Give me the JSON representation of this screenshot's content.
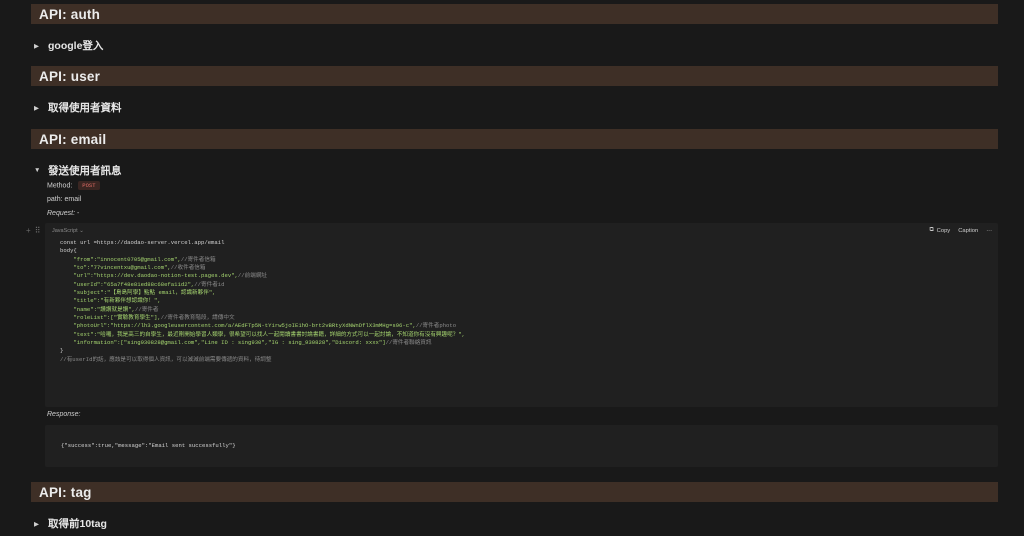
{
  "sections": {
    "auth": {
      "heading": "API: auth",
      "toggle": "google登入"
    },
    "user": {
      "heading": "API: user",
      "toggle": "取得使用者資料"
    },
    "email": {
      "heading": "API: email",
      "toggle": "發送使用者訊息",
      "method_label": "Method:",
      "method_value": "POST",
      "path": "path: email",
      "request_label": "Request:",
      "request_suffix": " -",
      "response_label": "Response:"
    },
    "tag": {
      "heading": "API: tag",
      "toggle": "取得前10tag"
    }
  },
  "code_block": {
    "language": "JavaScript",
    "copy_label": "Copy",
    "caption_label": "Caption",
    "more_label": "···",
    "lines": [
      [
        [
          "t",
          "const url =https://daodao-server.vercel.app/email"
        ]
      ],
      [
        [
          "t",
          "body{"
        ]
      ],
      [
        [
          "t",
          "    "
        ],
        [
          "s",
          "\"from\":\"innocent0705@gmail.com\","
        ],
        [
          "c",
          "//寄件者信箱"
        ]
      ],
      [
        [
          "t",
          "    "
        ],
        [
          "s",
          "\"to\":\"77vincentxu@gmail.com\","
        ],
        [
          "c",
          "//收件者信箱"
        ]
      ],
      [
        [
          "t",
          "    "
        ],
        [
          "s",
          "\"url\":\"https://dev.daodao-notion-test.pages.dev\","
        ],
        [
          "c",
          "//前端網址"
        ]
      ],
      [
        [
          "t",
          "    "
        ],
        [
          "s",
          "\"userId\":\"65a7f48e81ed88c68efa11d2\","
        ],
        [
          "c",
          "//寄件者id"
        ]
      ],
      [
        [
          "t",
          "    "
        ],
        [
          "s",
          "\"subject\":\"【島島阿學】點點 email，認識新夥伴\","
        ]
      ],
      [
        [
          "t",
          "    "
        ],
        [
          "s",
          "\"title\":\"有新夥伴想認識你！\","
        ]
      ],
      [
        [
          "t",
          "    "
        ],
        [
          "s",
          "\"name\":\"讚讚就是讚\","
        ],
        [
          "c",
          "//寄件者"
        ]
      ],
      [
        [
          "t",
          "    "
        ],
        [
          "s",
          "\"roleList\":[\"實驗教育學生\"],"
        ],
        [
          "c",
          "//寄件者教育階段，請傳中文"
        ]
      ],
      [
        [
          "t",
          "    "
        ],
        [
          "s",
          "\"photoUrl\":\"https://lh3.googleusercontent.com/a/AEdFTp5N-tYirw5joIE1hO-brt2vBRtyXdNWnDflX3mMHg=s96-c\","
        ],
        [
          "c",
          "//寄件者photo"
        ]
      ],
      [
        [
          "t",
          "    "
        ],
        [
          "s",
          "\"text\":\"哈囉，我是高三的自學生，最近剛開始學習人類學，很希望可以找人一起閱讀書書討論書籍，詳細的方式可以一起討論，不知道你有沒有興趣呢？\","
        ]
      ],
      [
        [
          "t",
          "    "
        ],
        [
          "s",
          "\"information\":[\"sing930828@gmail.com\",\"Line ID : sing930\",\"IG : sing_930828\",\"Discord: xxxx\"]"
        ],
        [
          "c",
          "//寄件者聯絡資訊"
        ]
      ],
      [
        [
          "t",
          "}"
        ]
      ],
      [
        [
          "c",
          "//有userId的話，應該是可以取得個人資訊，可以減減前端需要傳遞的資料，待調整"
        ]
      ]
    ]
  },
  "response_code": "{\"success\":true,\"message\":\"Email sent successfully\"}",
  "icons": {
    "toggle_open": "triangle-down-icon",
    "toggle_closed": "triangle-right-icon",
    "copy": "copy-icon",
    "more": "more-icon",
    "add": "plus-icon",
    "drag": "drag-handle-icon"
  },
  "colors": {
    "heading_bg": "#3e2f26",
    "page_bg": "#191919",
    "code_bg": "#202020",
    "string": "#a5d46f",
    "comment": "#8a8a8a",
    "post_badge": "#e06c66"
  }
}
